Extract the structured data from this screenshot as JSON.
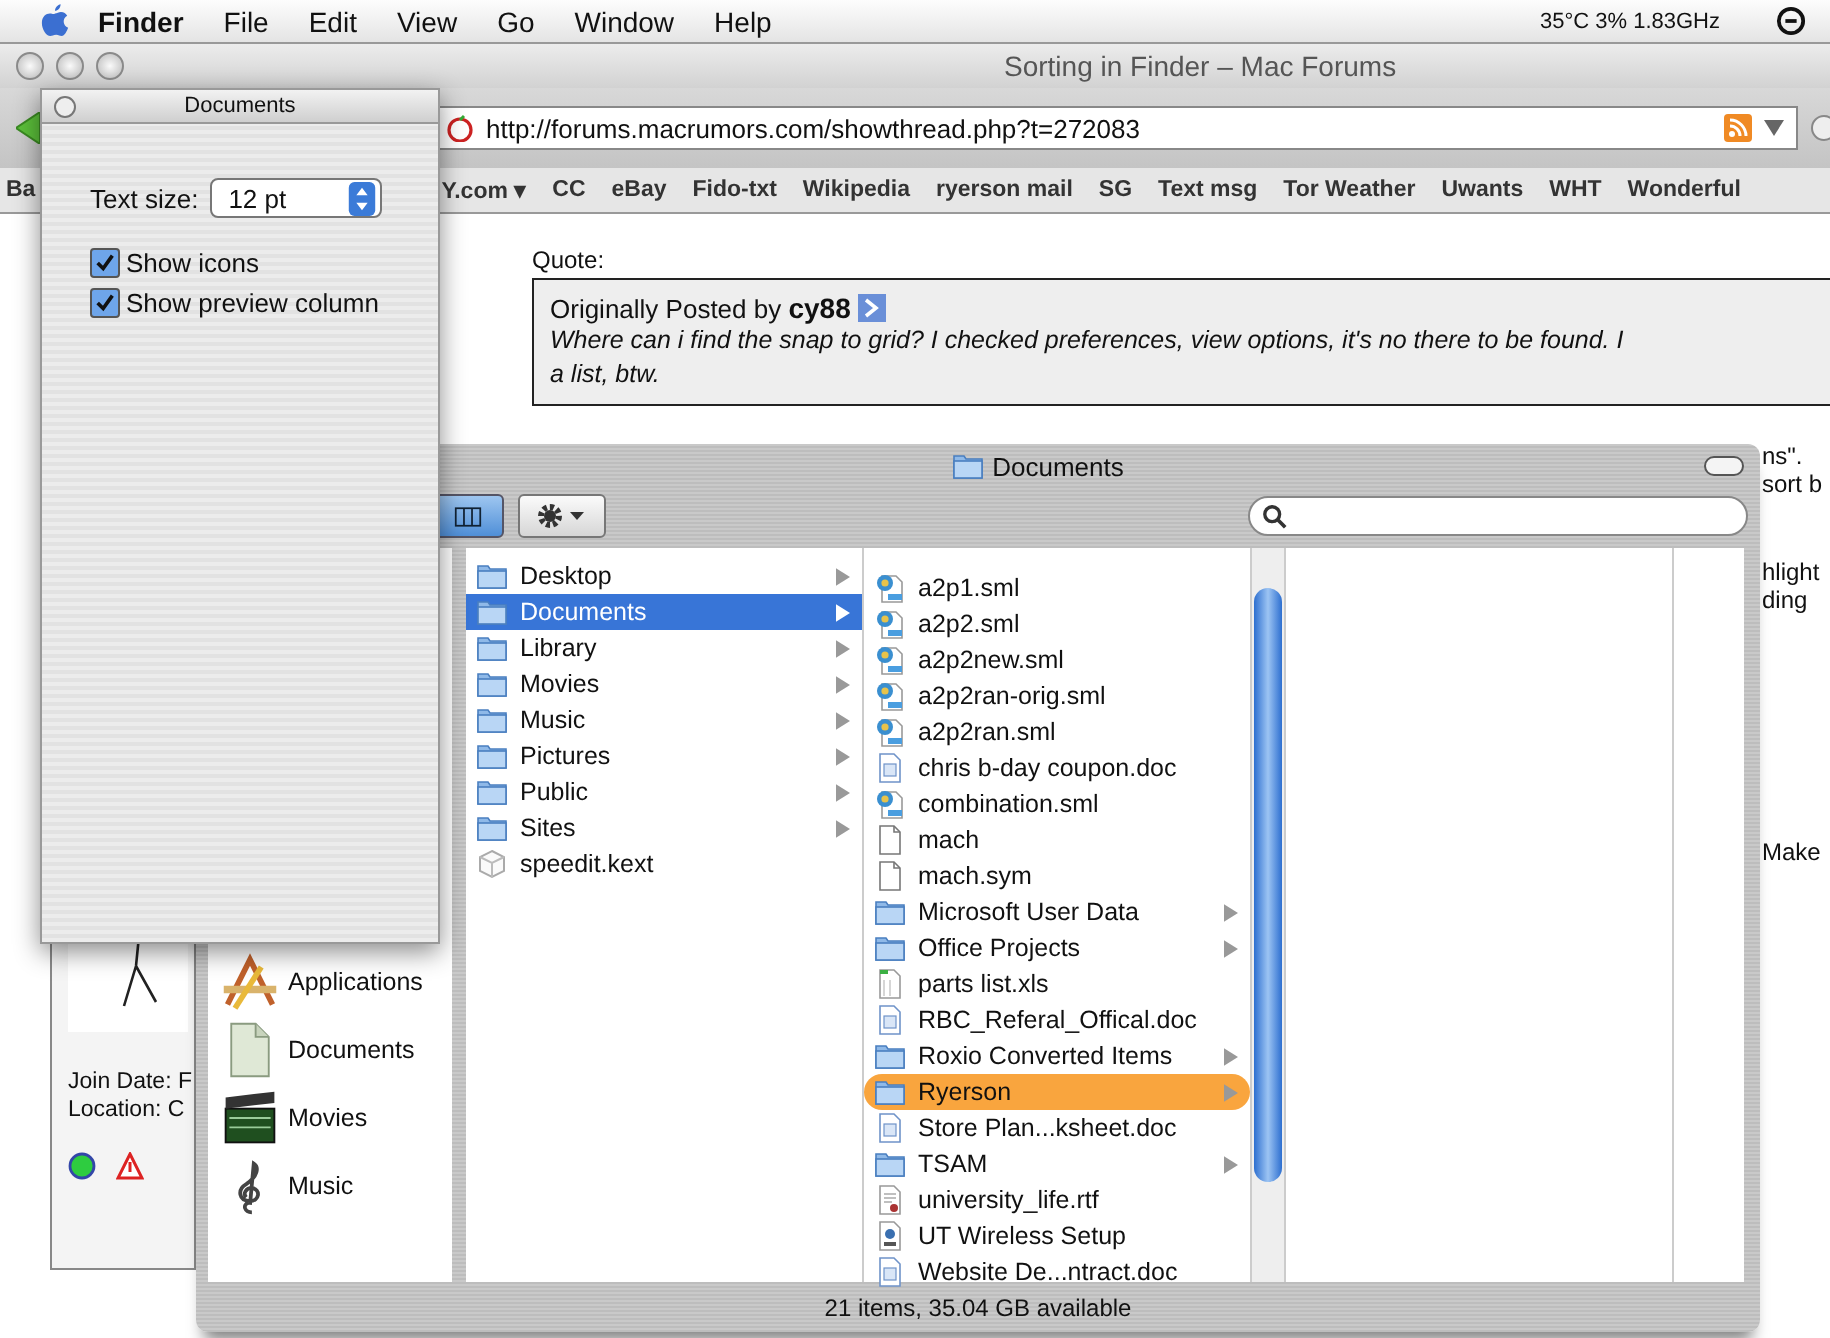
{
  "menu_bar": {
    "app": "Finder",
    "menus": [
      "File",
      "Edit",
      "View",
      "Go",
      "Window",
      "Help"
    ],
    "status": "35°C 3% 1.83GHz"
  },
  "browser": {
    "title": "Sorting in Finder – Mac Forums",
    "url": "http://forums.macrumors.com/showthread.php?t=272083",
    "bookmarks": [
      "Ba",
      "Y.com ▾",
      "CC",
      "eBay",
      "Fido-txt",
      "Wikipedia",
      "ryerson mail",
      "SG",
      "Text msg",
      "Tor Weather",
      "Uwants",
      "WHT",
      "Wonderful"
    ]
  },
  "post": {
    "quote_label": "Quote:",
    "attribution": "Originally Posted by **cy88**",
    "quote_lines": [
      "Where can i find the snap to grid? I checked preferences, view options, it's no there to be found. I",
      "a list, btw."
    ],
    "fragments": [
      "ns\".",
      "sort b",
      "hlight",
      "ding",
      "Make"
    ],
    "author_info": [
      "Join Date: F",
      "Location: C"
    ]
  },
  "finder": {
    "title": "Documents",
    "status": "21 items, 35.04 GB available",
    "sidebar": [
      {
        "name": "Applications",
        "kind": "applications"
      },
      {
        "name": "Documents",
        "kind": "documents"
      },
      {
        "name": "Movies",
        "kind": "movies"
      },
      {
        "name": "Music",
        "kind": "music"
      }
    ],
    "columns": [
      [
        {
          "name": "Desktop",
          "kind": "folder",
          "selected": false
        },
        {
          "name": "Documents",
          "kind": "folder",
          "selected": true
        },
        {
          "name": "Library",
          "kind": "folder",
          "selected": false
        },
        {
          "name": "Movies",
          "kind": "folder",
          "selected": false
        },
        {
          "name": "Music",
          "kind": "folder",
          "selected": false
        },
        {
          "name": "Pictures",
          "kind": "folder",
          "selected": false
        },
        {
          "name": "Public",
          "kind": "folder",
          "selected": false
        },
        {
          "name": "Sites",
          "kind": "folder",
          "selected": false
        },
        {
          "name": "speedit.kext",
          "kind": "kext",
          "selected": false
        }
      ],
      [
        {
          "name": "a2p1.sml",
          "kind": "sml",
          "selected": false
        },
        {
          "name": "a2p2.sml",
          "kind": "sml",
          "selected": false
        },
        {
          "name": "a2p2new.sml",
          "kind": "sml",
          "selected": false
        },
        {
          "name": "a2p2ran-orig.sml",
          "kind": "sml",
          "selected": false
        },
        {
          "name": "a2p2ran.sml",
          "kind": "sml",
          "selected": false
        },
        {
          "name": "chris b-day coupon.doc",
          "kind": "doc",
          "selected": false
        },
        {
          "name": "combination.sml",
          "kind": "sml",
          "selected": false
        },
        {
          "name": "mach",
          "kind": "plain",
          "selected": false
        },
        {
          "name": "mach.sym",
          "kind": "plain",
          "selected": false
        },
        {
          "name": "Microsoft User Data",
          "kind": "folder",
          "selected": false
        },
        {
          "name": "Office Projects",
          "kind": "folder",
          "selected": false
        },
        {
          "name": "parts list.xls",
          "kind": "xls",
          "selected": false
        },
        {
          "name": "RBC_Referal_Offical.doc",
          "kind": "doc",
          "selected": false
        },
        {
          "name": "Roxio Converted Items",
          "kind": "folder",
          "selected": false
        },
        {
          "name": "Ryerson",
          "kind": "folder",
          "selected": false,
          "color": "#f9a53e"
        },
        {
          "name": "Store Plan...ksheet.doc",
          "kind": "doc",
          "selected": false
        },
        {
          "name": "TSAM",
          "kind": "folder",
          "selected": false
        },
        {
          "name": "university_life.rtf",
          "kind": "rtf",
          "selected": false
        },
        {
          "name": "UT Wireless Setup",
          "kind": "app",
          "selected": false
        },
        {
          "name": "Website De...ntract.doc",
          "kind": "doc",
          "selected": false
        }
      ]
    ]
  },
  "view_options": {
    "title": "Documents",
    "text_size_label": "Text size:",
    "text_size": "12 pt",
    "options": [
      {
        "label": "Show icons",
        "checked": true
      },
      {
        "label": "Show preview column",
        "checked": true
      }
    ]
  }
}
